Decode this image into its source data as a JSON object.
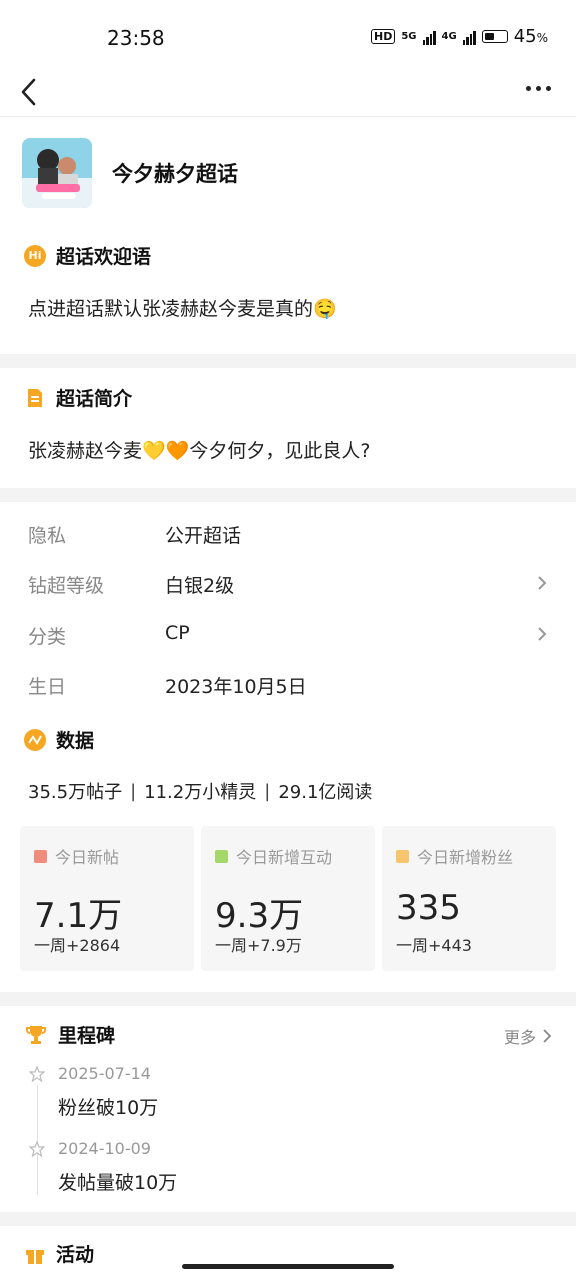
{
  "status_bar": {
    "time": "23:58",
    "hd": "HD",
    "net1": "5G",
    "net2": "4G",
    "battery": "45",
    "battery_unit": "%"
  },
  "nav": {
    "back_icon": "chevron-left-icon",
    "more_icon": "more-dots-icon"
  },
  "header": {
    "title": "今夕赫夕超话"
  },
  "welcome": {
    "heading": "超话欢迎语",
    "icon_text": "Hi",
    "text": "点进超话默认张凌赫赵今麦是真的🤤"
  },
  "intro": {
    "heading": "超话简介",
    "text": "张凌赫赵今麦💛🧡今夕何夕，见此良人?"
  },
  "info": [
    {
      "key": "隐私",
      "value": "公开超话",
      "arrow": false
    },
    {
      "key": "钻超等级",
      "value": "白银2级",
      "arrow": true
    },
    {
      "key": "分类",
      "value": "CP",
      "arrow": true
    },
    {
      "key": "生日",
      "value": "2023年10月5日",
      "arrow": false
    }
  ],
  "stats": {
    "heading": "数据",
    "summary": [
      "35.5万帖子",
      "11.2万小精灵",
      "29.1亿阅读"
    ],
    "separator": "|",
    "cards": [
      {
        "label": "今日新帖",
        "value": "7.1万",
        "week": "一周+2864",
        "color": "#f08c7c"
      },
      {
        "label": "今日新增互动",
        "value": "9.3万",
        "week": "一周+7.9万",
        "color": "#a5d86a"
      },
      {
        "label": "今日新增粉丝",
        "value": "335",
        "week": "一周+443",
        "color": "#f8c46d"
      }
    ]
  },
  "milestones": {
    "heading": "里程碑",
    "more": "更多",
    "items": [
      {
        "date": "2025-07-14",
        "text": "粉丝破10万"
      },
      {
        "date": "2024-10-09",
        "text": "发帖量破10万"
      }
    ]
  },
  "activity": {
    "heading": "活动"
  },
  "colors": {
    "accent": "#f5a623",
    "divider": "#f3f3f3"
  }
}
